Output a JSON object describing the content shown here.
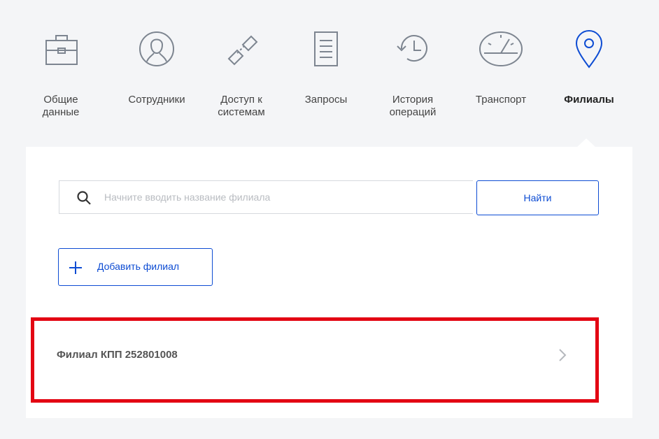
{
  "nav": {
    "items": [
      {
        "label": "Общие\nданные",
        "icon": "briefcase-icon"
      },
      {
        "label": "Сотрудники",
        "icon": "person-icon"
      },
      {
        "label": "Доступ к\nсистемам",
        "icon": "link-icon"
      },
      {
        "label": "Запросы",
        "icon": "document-icon"
      },
      {
        "label": "История\nопераций",
        "icon": "history-icon"
      },
      {
        "label": "Транспорт",
        "icon": "speedometer-icon"
      },
      {
        "label": "Филиалы",
        "icon": "location-pin-icon"
      }
    ],
    "active_index": 6,
    "accent_color": "#0d4cd3",
    "icon_color": "#7d8590"
  },
  "search": {
    "placeholder": "Начните вводить название филиала",
    "value": "",
    "button_label": "Найти"
  },
  "add_button": {
    "label": "Добавить филиал"
  },
  "branches": [
    {
      "name": "Филиал КПП 252801008"
    }
  ],
  "highlight_color": "#e30613"
}
